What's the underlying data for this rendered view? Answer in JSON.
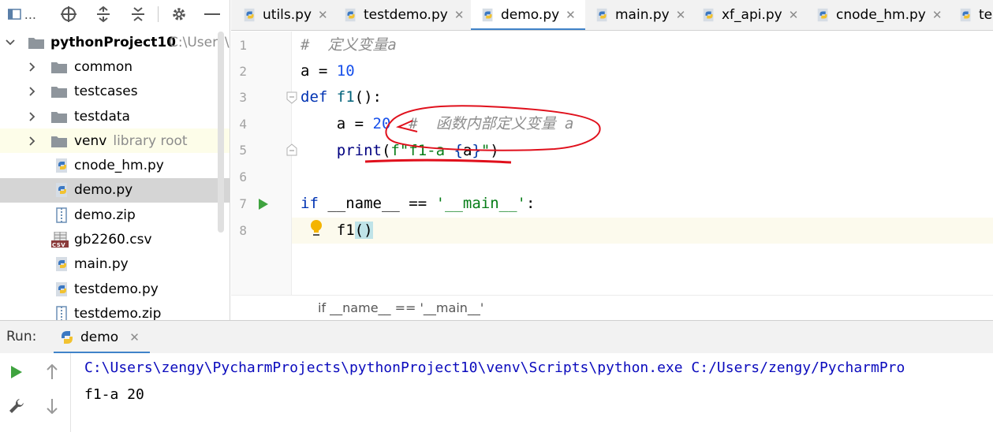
{
  "project_panel": {
    "toolbar_more": "...",
    "root": {
      "name": "pythonProject10",
      "path": "C:\\Users\\z"
    },
    "items": [
      {
        "kind": "folder",
        "label": "common",
        "hint": ""
      },
      {
        "kind": "folder",
        "label": "testcases",
        "hint": ""
      },
      {
        "kind": "folder",
        "label": "testdata",
        "hint": ""
      },
      {
        "kind": "folder",
        "label": "venv",
        "hint": "library root"
      },
      {
        "kind": "py",
        "label": "cnode_hm.py",
        "hint": ""
      },
      {
        "kind": "py",
        "label": "demo.py",
        "hint": ""
      },
      {
        "kind": "zip",
        "label": "demo.zip",
        "hint": ""
      },
      {
        "kind": "csv",
        "label": "gb2260.csv",
        "hint": ""
      },
      {
        "kind": "py",
        "label": "main.py",
        "hint": ""
      },
      {
        "kind": "py",
        "label": "testdemo.py",
        "hint": ""
      },
      {
        "kind": "zip",
        "label": "testdemo.zip",
        "hint": ""
      }
    ],
    "csv_badge": "CSV"
  },
  "tabs": [
    {
      "label": "utils.py",
      "active": false
    },
    {
      "label": "testdemo.py",
      "active": false
    },
    {
      "label": "demo.py",
      "active": true
    },
    {
      "label": "main.py",
      "active": false
    },
    {
      "label": "xf_api.py",
      "active": false
    },
    {
      "label": "cnode_hm.py",
      "active": false
    },
    {
      "label": "te",
      "active": false
    }
  ],
  "tab_close_glyph": "✕",
  "editor": {
    "line_numbers": [
      "1",
      "2",
      "3",
      "4",
      "5",
      "6",
      "7",
      "8"
    ],
    "code": {
      "l1_comment": "#  定义变量a",
      "l2_var": "a = ",
      "l2_num": "10",
      "l3_kw": "def ",
      "l3_fn": "f1",
      "l3_rest": "():",
      "l4_indent": "    a = ",
      "l4_num": "20",
      "l4_comment": "  #  函数内部定义变量 a",
      "l5_builtin": "    print",
      "l5_open": "(",
      "l5_str_pre": "f\"f1-a ",
      "l5_brace_open": "{",
      "l5_var": "a",
      "l5_brace_close": "}",
      "l5_str_post": "\"",
      "l5_close": ")",
      "l7_kw": "if ",
      "l7_dunder": "__name__",
      "l7_op": " == ",
      "l7_str": "'__main__'",
      "l7_colon": ":",
      "l8_call": "    f1",
      "l8_paren_open": "(",
      "l8_paren_close": ")"
    },
    "breadcrumb": "if __name__ == '__main__'"
  },
  "run_panel": {
    "label": "Run:",
    "tab": "demo",
    "console": [
      "C:\\Users\\zengy\\PycharmProjects\\pythonProject10\\venv\\Scripts\\python.exe C:/Users/zengy/PycharmPro",
      "f1-a 20"
    ]
  },
  "colors": {
    "accent": "#4083c9",
    "keyword": "#0033b3",
    "number": "#1750eb",
    "string": "#067d17",
    "comment": "#8c8c8c",
    "annotation_red": "#e0101c"
  }
}
